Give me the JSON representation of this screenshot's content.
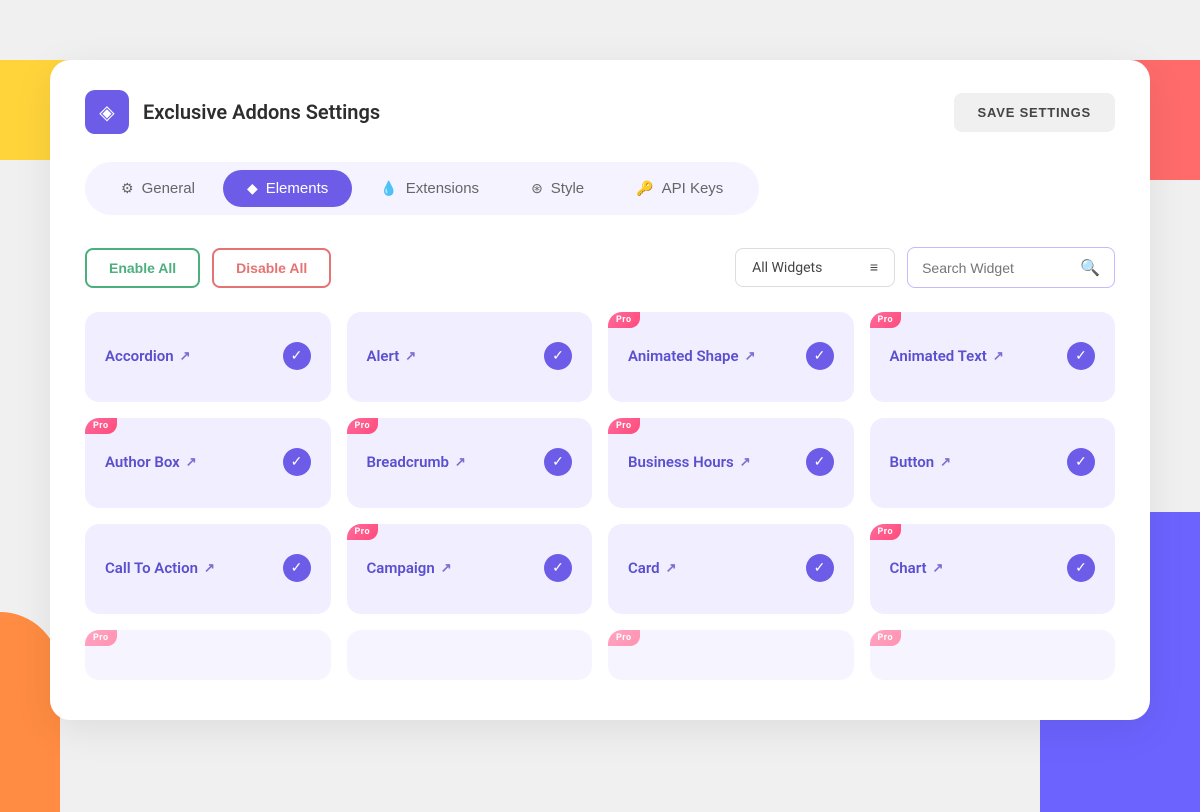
{
  "background": {
    "yellow_desc": "top-left yellow blob",
    "red_desc": "top-right red blob",
    "blue_desc": "bottom-right blue blob",
    "orange_desc": "bottom-left orange blob"
  },
  "header": {
    "logo_icon": "◈",
    "title": "Exclusive Addons Settings",
    "save_button_label": "SAVE SETTINGS"
  },
  "tabs": [
    {
      "id": "general",
      "label": "General",
      "icon": "⚙",
      "active": false
    },
    {
      "id": "elements",
      "label": "Elements",
      "icon": "◆",
      "active": true
    },
    {
      "id": "extensions",
      "label": "Extensions",
      "icon": "💧",
      "active": false
    },
    {
      "id": "style",
      "label": "Style",
      "icon": "⊛",
      "active": false
    },
    {
      "id": "api-keys",
      "label": "API Keys",
      "icon": "🔑",
      "active": false
    }
  ],
  "controls": {
    "enable_all_label": "Enable All",
    "disable_all_label": "Disable All",
    "dropdown_label": "All Widgets",
    "dropdown_icon": "filter",
    "search_placeholder": "Search Widget",
    "search_icon": "search"
  },
  "widgets": [
    {
      "id": "accordion",
      "name": "Accordion",
      "enabled": true,
      "pro": false
    },
    {
      "id": "alert",
      "name": "Alert",
      "enabled": true,
      "pro": false
    },
    {
      "id": "animated-shape",
      "name": "Animated Shape",
      "enabled": true,
      "pro": true
    },
    {
      "id": "animated-text",
      "name": "Animated Text",
      "enabled": true,
      "pro": true
    },
    {
      "id": "author-box",
      "name": "Author Box",
      "enabled": true,
      "pro": true
    },
    {
      "id": "breadcrumb",
      "name": "Breadcrumb",
      "enabled": true,
      "pro": true
    },
    {
      "id": "business-hours",
      "name": "Business Hours",
      "enabled": true,
      "pro": true
    },
    {
      "id": "button",
      "name": "Button",
      "enabled": true,
      "pro": false
    },
    {
      "id": "call-to-action",
      "name": "Call To Action",
      "enabled": true,
      "pro": false
    },
    {
      "id": "campaign",
      "name": "Campaign",
      "enabled": true,
      "pro": true
    },
    {
      "id": "card",
      "name": "Card",
      "enabled": true,
      "pro": false
    },
    {
      "id": "chart",
      "name": "Chart",
      "enabled": true,
      "pro": true
    },
    {
      "id": "widget-13",
      "name": "...",
      "enabled": true,
      "pro": true
    },
    {
      "id": "widget-14",
      "name": "...",
      "enabled": true,
      "pro": false
    },
    {
      "id": "widget-15",
      "name": "...",
      "enabled": true,
      "pro": false
    },
    {
      "id": "widget-16",
      "name": "...",
      "enabled": true,
      "pro": true
    }
  ],
  "colors": {
    "primary": "#6C5CE7",
    "bg_card": "#f0eeff",
    "text_widget": "#5a4fcf",
    "pro_badge": "#FF4B7B",
    "enable_btn_border": "#4CAF7D",
    "disable_btn_border": "#E57373"
  }
}
